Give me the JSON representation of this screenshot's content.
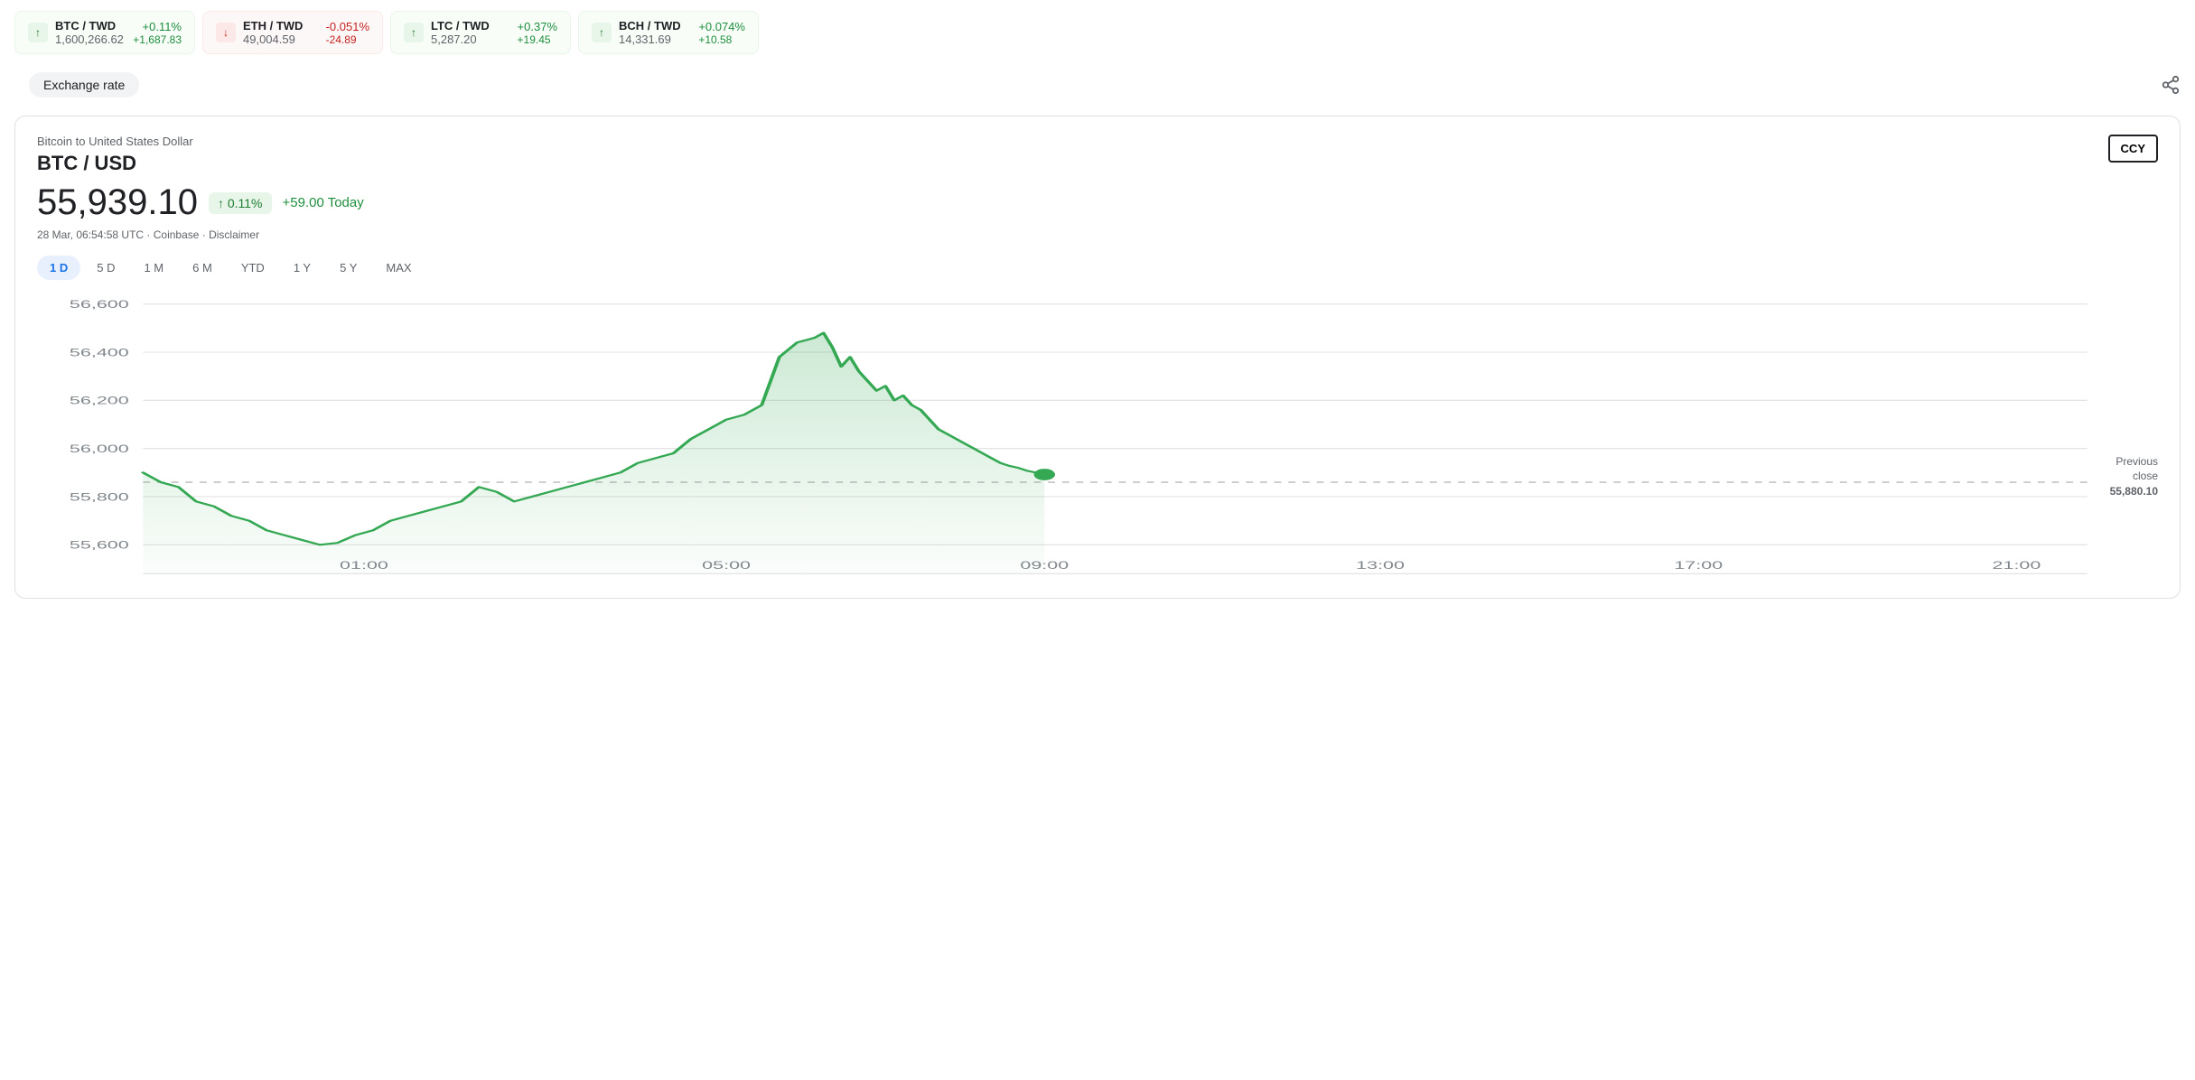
{
  "ticker": {
    "items": [
      {
        "pair": "BTC / TWD",
        "price": "1,600,266.62",
        "change_pct": "+0.11%",
        "change_abs": "+1,687.83",
        "direction": "up"
      },
      {
        "pair": "ETH / TWD",
        "price": "49,004.59",
        "change_pct": "-0.051%",
        "change_abs": "-24.89",
        "direction": "down"
      },
      {
        "pair": "LTC / TWD",
        "price": "5,287.20",
        "change_pct": "+0.37%",
        "change_abs": "+19.45",
        "direction": "up"
      },
      {
        "pair": "BCH / TWD",
        "price": "14,331.69",
        "change_pct": "+0.074%",
        "change_abs": "+10.58",
        "direction": "up"
      }
    ]
  },
  "exchange_rate_label": "Exchange rate",
  "share_icon": "⤢",
  "chart": {
    "subtitle": "Bitcoin to United States Dollar",
    "pair": "BTC / USD",
    "price": "55,939.10",
    "change_pct": "↑ 0.11%",
    "change_today": "+59.00 Today",
    "meta": "28 Mar, 06:54:58 UTC · Coinbase · Disclaimer",
    "ccy_button": "CCY",
    "prev_close_label": "Previous\nclose\n55,880.10",
    "prev_close_value": "55,880.10",
    "periods": [
      "1 D",
      "5 D",
      "1 M",
      "6 M",
      "YTD",
      "1 Y",
      "5 Y",
      "MAX"
    ],
    "active_period": "1 D",
    "y_labels": [
      "56,600",
      "56,400",
      "56,200",
      "56,000",
      "55,800",
      "55,600"
    ],
    "x_labels": [
      "01:00",
      "05:00",
      "09:00",
      "13:00",
      "17:00",
      "21:00"
    ]
  }
}
